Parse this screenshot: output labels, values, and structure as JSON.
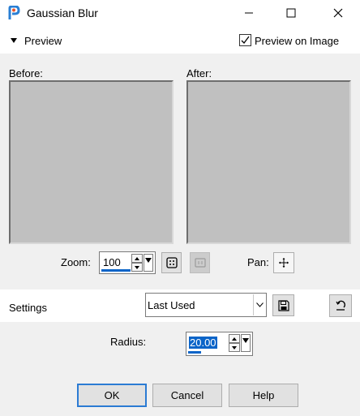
{
  "window": {
    "title": "Gaussian Blur",
    "icon": "paintshop-pro-icon",
    "controls": [
      "minimize-icon",
      "maximize-icon",
      "close-icon"
    ]
  },
  "preview": {
    "header_label": "Preview",
    "preview_on_image_label": "Preview on Image",
    "preview_on_image_checked": true,
    "before_label": "Before:",
    "after_label": "After:",
    "zoom_label": "Zoom:",
    "zoom_value": "100",
    "pan_label": "Pan:"
  },
  "settings": {
    "label": "Settings",
    "preset_value": "Last Used"
  },
  "params": {
    "radius_label": "Radius:",
    "radius_value": "20.00"
  },
  "buttons": {
    "ok": "OK",
    "cancel": "Cancel",
    "help": "Help"
  },
  "colors": {
    "accent": "#0a64c8",
    "preview_fill": "#c0c0c0",
    "default_button_border": "#2b7bd3"
  }
}
